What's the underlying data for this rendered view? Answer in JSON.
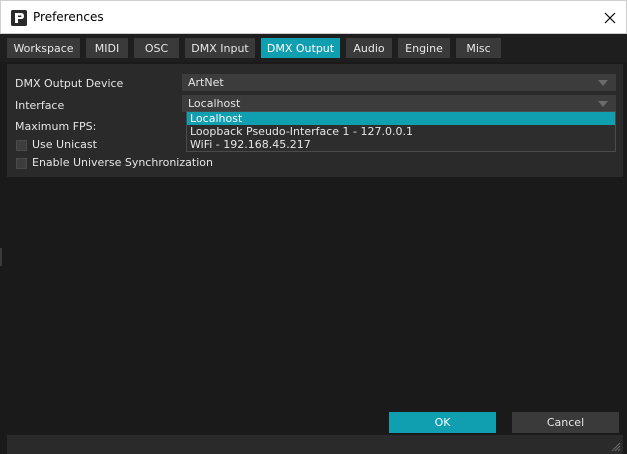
{
  "window": {
    "title": "Preferences",
    "close_icon": "close-icon",
    "app_icon": "app-logo-icon"
  },
  "tabs": [
    {
      "label": "Workspace",
      "active": false
    },
    {
      "label": "MIDI",
      "active": false
    },
    {
      "label": "OSC",
      "active": false
    },
    {
      "label": "DMX Input",
      "active": false
    },
    {
      "label": "DMX Output",
      "active": true
    },
    {
      "label": "Audio",
      "active": false
    },
    {
      "label": "Engine",
      "active": false
    },
    {
      "label": "Misc",
      "active": false
    }
  ],
  "dmx_output": {
    "device_label": "DMX Output Device",
    "device_value": "ArtNet",
    "interface_label": "Interface",
    "interface_value": "Localhost",
    "max_fps_label": "Maximum FPS:",
    "use_unicast_label": "Use Unicast",
    "use_unicast_checked": false,
    "universe_sync_label": "Enable Universe Synchronization",
    "universe_sync_checked": false
  },
  "interface_dropdown": {
    "open": true,
    "options": [
      "Localhost",
      "Loopback Pseudo-Interface 1 - 127.0.0.1",
      "WiFi - 192.168.45.217"
    ],
    "selected_index": 0
  },
  "buttons": {
    "ok_label": "OK",
    "cancel_label": "Cancel"
  },
  "colors": {
    "accent": "#0f9fb1",
    "background": "#1a1a1a",
    "panel": "#2a2a2a"
  }
}
